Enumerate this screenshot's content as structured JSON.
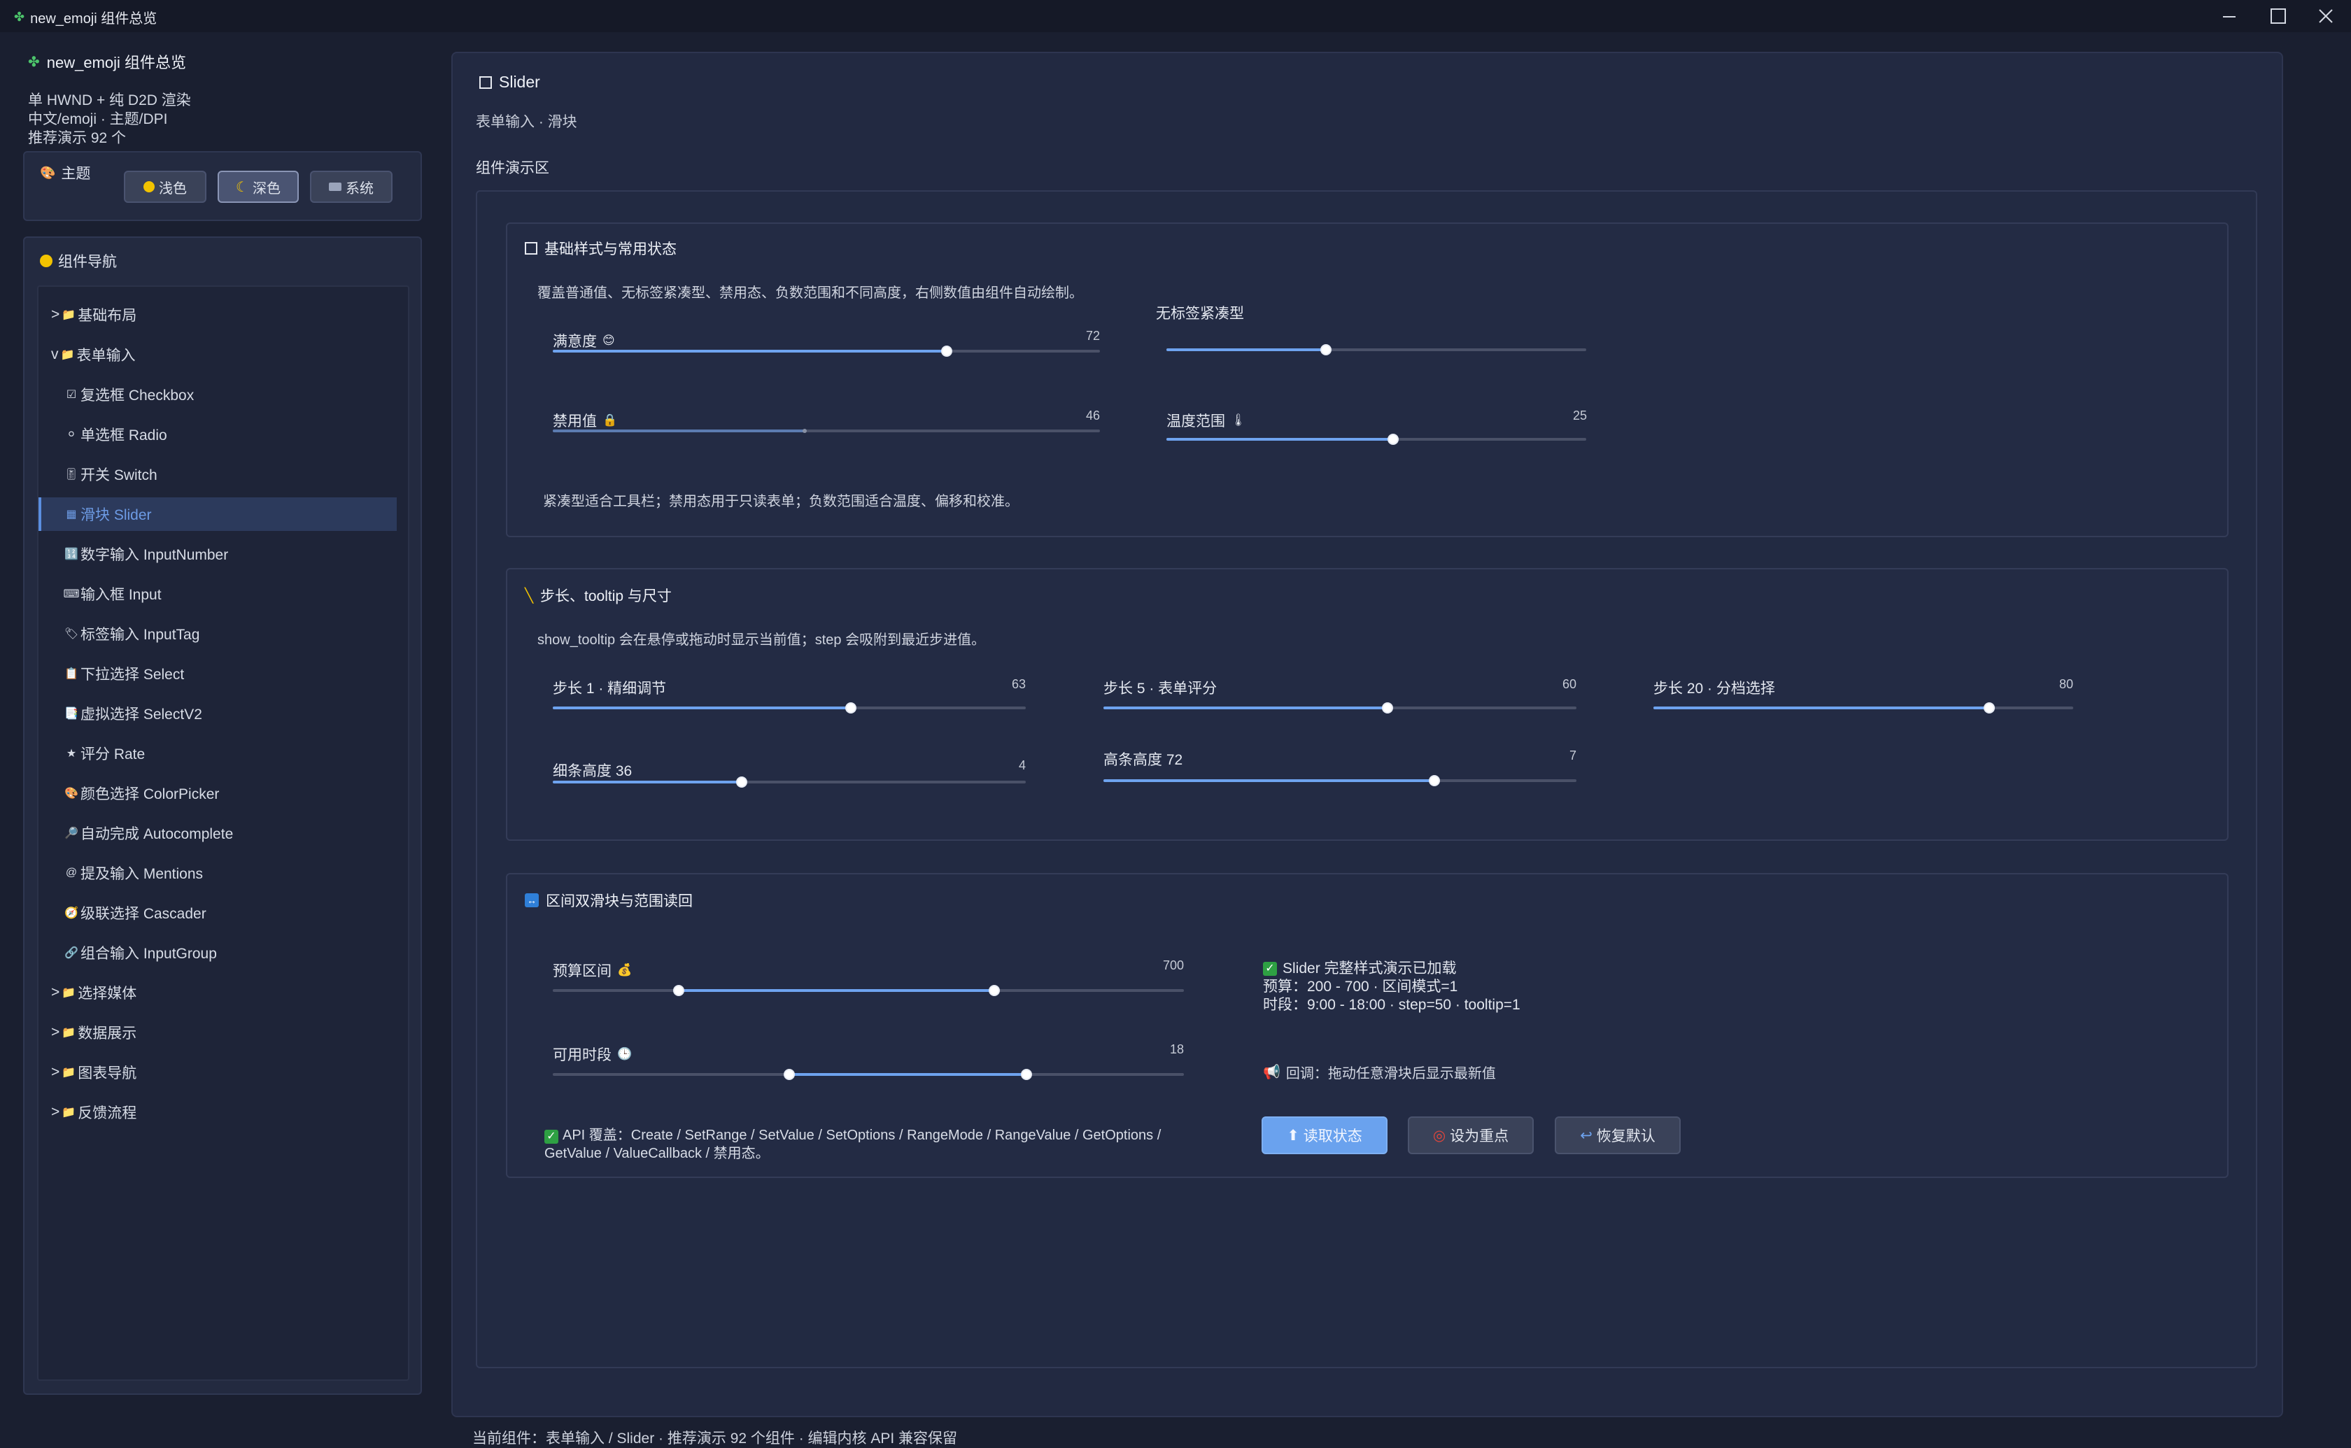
{
  "window": {
    "title": "new_emoji 组件总览",
    "controls": [
      "minimize",
      "maximize",
      "close"
    ]
  },
  "sidebar": {
    "app_title": "new_emoji 组件总览",
    "info_lines": [
      "单 HWND + 纯 D2D 渲染",
      "中文/emoji · 主题/DPI",
      "推荐演示 92 个"
    ],
    "theme": {
      "label": "主题",
      "options": [
        {
          "label": "浅色",
          "icon": "🟡"
        },
        {
          "label": "深色",
          "icon": "🌙",
          "active": true
        },
        {
          "label": "系统",
          "icon": "💻"
        }
      ]
    },
    "nav": {
      "label": "组件导航",
      "items": [
        {
          "prefix": ">",
          "icon": "📁",
          "label": "基础布局",
          "indent": 0
        },
        {
          "prefix": "v",
          "icon": "📁",
          "label": "表单输入",
          "indent": 0
        },
        {
          "prefix": "",
          "icon": "☑",
          "label": "复选框 Checkbox",
          "indent": 1
        },
        {
          "prefix": "",
          "icon": "⚪",
          "label": "单选框 Radio",
          "indent": 1
        },
        {
          "prefix": "",
          "icon": "🎚",
          "label": "开关 Switch",
          "indent": 1
        },
        {
          "prefix": "",
          "icon": "▦",
          "label": "滑块 Slider",
          "indent": 1,
          "active": true
        },
        {
          "prefix": "",
          "icon": "🔢",
          "label": "数字输入 InputNumber",
          "indent": 1
        },
        {
          "prefix": "",
          "icon": "⌨",
          "label": "输入框 Input",
          "indent": 1
        },
        {
          "prefix": "",
          "icon": "🏷",
          "label": "标签输入 InputTag",
          "indent": 1
        },
        {
          "prefix": "",
          "icon": "📋",
          "label": "下拉选择 Select",
          "indent": 1
        },
        {
          "prefix": "",
          "icon": "📑",
          "label": "虚拟选择 SelectV2",
          "indent": 1
        },
        {
          "prefix": "",
          "icon": "★",
          "label": "评分 Rate",
          "indent": 1
        },
        {
          "prefix": "",
          "icon": "🎨",
          "label": "颜色选择 ColorPicker",
          "indent": 1
        },
        {
          "prefix": "",
          "icon": "🔎",
          "label": "自动完成 Autocomplete",
          "indent": 1
        },
        {
          "prefix": "",
          "icon": "@",
          "label": "提及输入 Mentions",
          "indent": 1
        },
        {
          "prefix": "",
          "icon": "🧭",
          "label": "级联选择 Cascader",
          "indent": 1
        },
        {
          "prefix": "",
          "icon": "🔗",
          "label": "组合输入 InputGroup",
          "indent": 1
        },
        {
          "prefix": ">",
          "icon": "📁",
          "label": "选择媒体",
          "indent": 0
        },
        {
          "prefix": ">",
          "icon": "📁",
          "label": "数据展示",
          "indent": 0
        },
        {
          "prefix": ">",
          "icon": "📁",
          "label": "图表导航",
          "indent": 0
        },
        {
          "prefix": ">",
          "icon": "📁",
          "label": "反馈流程",
          "indent": 0
        }
      ]
    }
  },
  "main": {
    "title": "Slider",
    "subtitle": "表单输入 · 滑块",
    "demo_label": "组件演示区",
    "basic": {
      "title": "基础样式与常用状态",
      "desc": "覆盖普通值、无标签紧凑型、禁用态、负数范围和不同高度，右侧数值由组件自动绘制。",
      "compact_label": "无标签紧凑型",
      "sliders": [
        {
          "id": "satisfaction",
          "label": "满意度",
          "icon": "😊",
          "value": "72",
          "fraction": 0.72
        },
        {
          "id": "compact",
          "label": "",
          "icon": "",
          "value": "",
          "fraction": 0.38
        },
        {
          "id": "disabled",
          "label": "禁用值",
          "icon": "🔒",
          "value": "46",
          "fraction": 0.46,
          "disabled": true
        },
        {
          "id": "temperature",
          "label": "温度范围",
          "icon": "🌡",
          "value": "25",
          "fraction": 0.54
        }
      ],
      "footer": "紧凑型适合工具栏；禁用态用于只读表单；负数范围适合温度、偏移和校准。"
    },
    "step": {
      "title": "步长、tooltip 与尺寸",
      "desc": "show_tooltip 会在悬停或拖动时显示当前值；step 会吸附到最近步进值。",
      "sliders": [
        {
          "id": "step1",
          "label": "步长 1 · 精细调节",
          "value": "63",
          "fraction": 0.63
        },
        {
          "id": "step5",
          "label": "步长 5 · 表单评分",
          "value": "60",
          "fraction": 0.6
        },
        {
          "id": "step20",
          "label": "步长 20 · 分档选择",
          "value": "80",
          "fraction": 0.8
        },
        {
          "id": "thin",
          "label": "细条高度 36",
          "value": "4",
          "fraction": 0.4
        },
        {
          "id": "tall",
          "label": "高条高度 72",
          "value": "7",
          "fraction": 0.7
        }
      ]
    },
    "range": {
      "title": "区间双滑块与范围读回",
      "sliders": [
        {
          "id": "budget",
          "label": "预算区间",
          "icon": "💰",
          "value": "700",
          "from": 0.2,
          "to": 0.7
        },
        {
          "id": "time",
          "label": "可用时段",
          "icon": "🕒",
          "value": "18",
          "from": 0.375,
          "to": 0.75
        }
      ],
      "status": {
        "title": "Slider 完整样式演示已加载",
        "line1": "预算：200 - 700 · 区间模式=1",
        "line2": "时段：9:00 - 18:00 · step=50 · tooltip=1"
      },
      "callback": "回调：拖动任意滑块后显示最新值",
      "api": "API 覆盖：Create / SetRange / SetValue / SetOptions / RangeMode / RangeValue / GetOptions / GetValue / ValueCallback / 禁用态。",
      "buttons": [
        {
          "label": "读取状态",
          "icon": "⬆",
          "primary": true
        },
        {
          "label": "设为重点",
          "icon": "🎯"
        },
        {
          "label": "恢复默认",
          "icon": "↩"
        }
      ]
    }
  },
  "status_bar": "当前组件：表单输入 / Slider · 推荐演示 92 个组件 · 编辑内核 API 兼容保留",
  "colors": {
    "accent": "#6ea3ef",
    "background": "#1a1f30",
    "panel": "#232a40",
    "active_nav": "#2c3a5c",
    "success": "#2ea043"
  }
}
